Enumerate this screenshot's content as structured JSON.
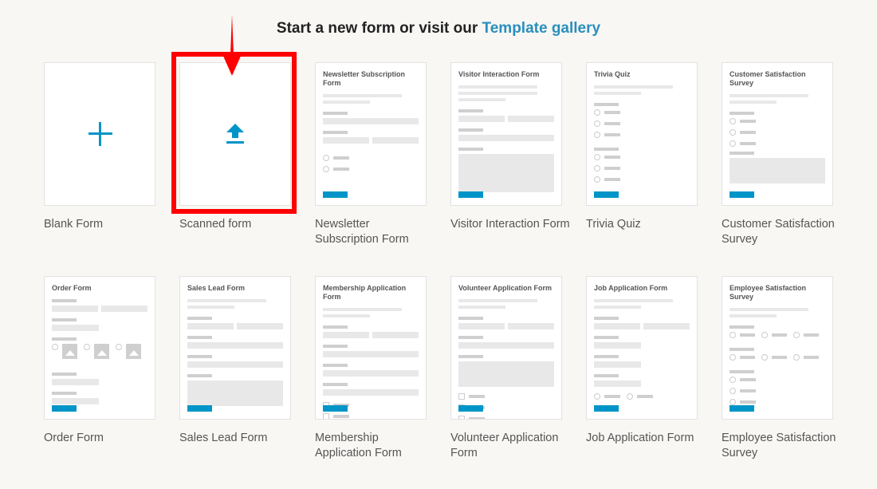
{
  "heading": {
    "text": "Start a new form or visit our ",
    "link": "Template gallery"
  },
  "colors": {
    "accent": "#0095c8",
    "link": "#2a8fbd",
    "highlight": "#ff0000"
  },
  "highlight_index": 1,
  "cards": [
    {
      "name": "Blank Form",
      "icon": "plus-icon"
    },
    {
      "name": "Scanned form",
      "icon": "upload-icon"
    },
    {
      "name": "Newsletter Subscription Form",
      "thumb_title": "Newsletter Subscription Form"
    },
    {
      "name": "Visitor Interaction Form",
      "thumb_title": "Visitor Interaction Form"
    },
    {
      "name": "Trivia Quiz",
      "thumb_title": "Trivia Quiz"
    },
    {
      "name": "Customer Satisfaction Survey",
      "thumb_title": "Customer Satisfaction Survey"
    },
    {
      "name": "Order Form",
      "thumb_title": "Order Form"
    },
    {
      "name": "Sales Lead Form",
      "thumb_title": "Sales Lead Form"
    },
    {
      "name": "Membership Application Form",
      "thumb_title": "Membership Application Form"
    },
    {
      "name": "Volunteer Application Form",
      "thumb_title": "Volunteer Application Form"
    },
    {
      "name": "Job Application Form",
      "thumb_title": "Job Application Form"
    },
    {
      "name": "Employee Satisfaction Survey",
      "thumb_title": "Employee Satisfaction Survey"
    }
  ]
}
